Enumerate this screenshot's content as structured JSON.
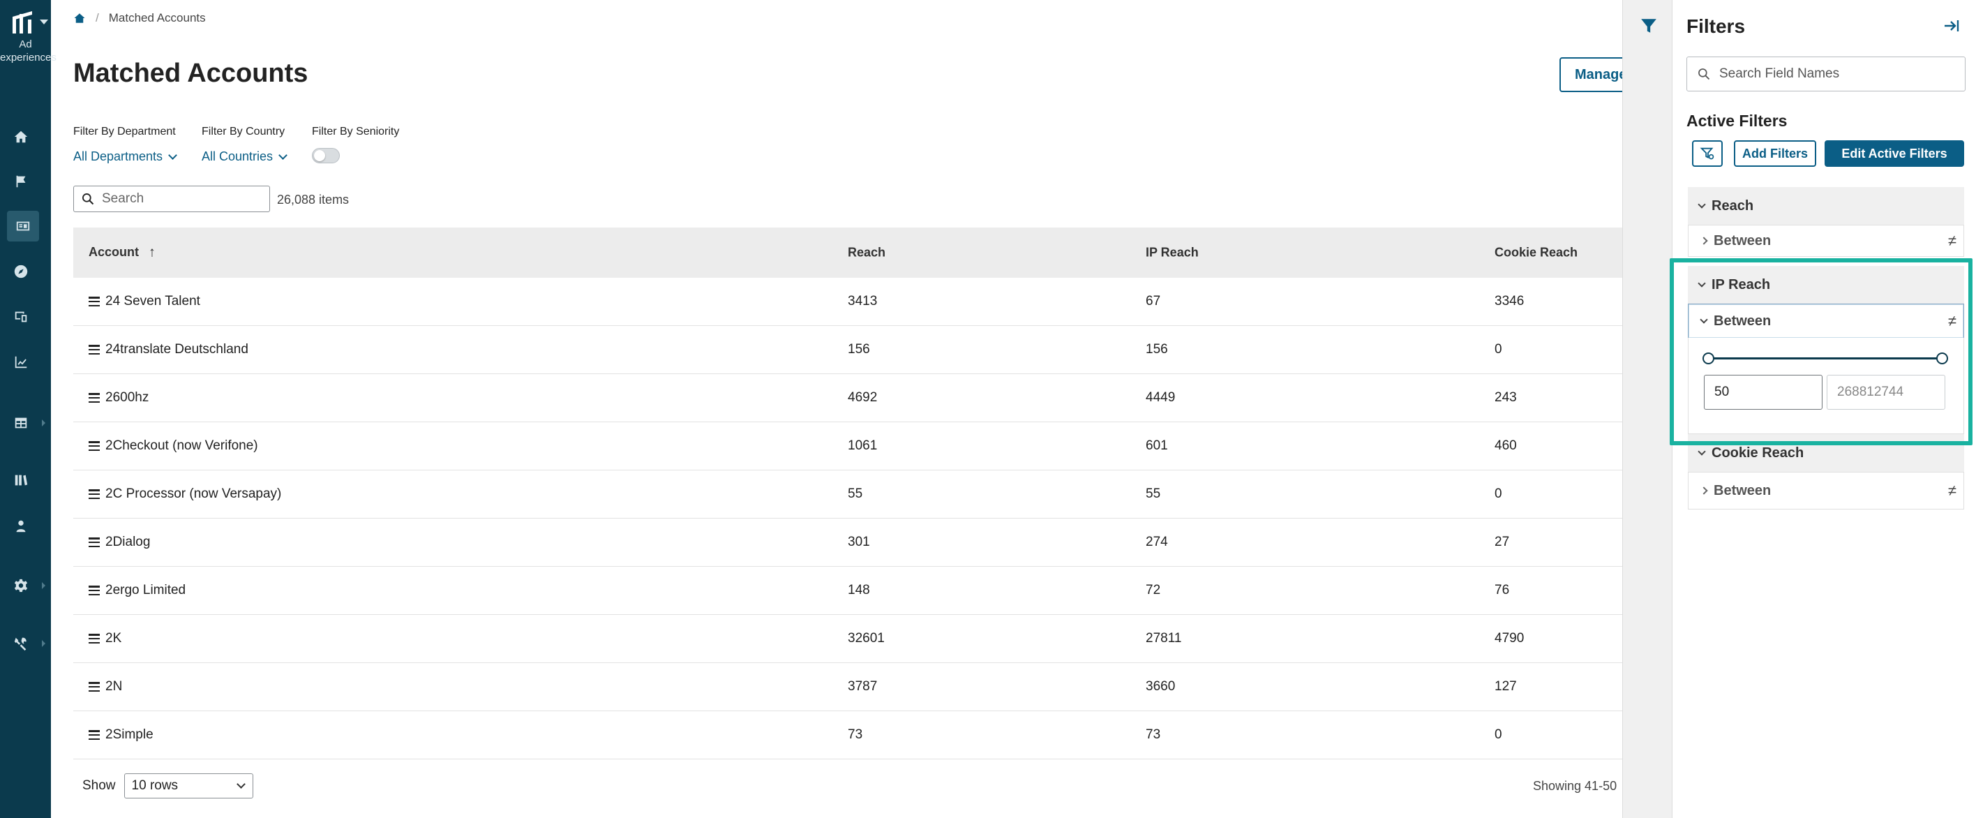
{
  "app": {
    "logo_text": "Ad experiences"
  },
  "breadcrumb": {
    "current": "Matched Accounts"
  },
  "page": {
    "title": "Matched Accounts",
    "manage_label": "Manage"
  },
  "filters_bar": {
    "department": {
      "label": "Filter By Department",
      "value": "All Departments"
    },
    "country": {
      "label": "Filter By Country",
      "value": "All Countries"
    },
    "seniority": {
      "label": "Filter By Seniority",
      "enabled": false
    }
  },
  "search": {
    "placeholder": "Search",
    "item_count": "26,088 items"
  },
  "table": {
    "columns": [
      "Account",
      "Reach",
      "IP Reach",
      "Cookie Reach"
    ],
    "sort_column": "Account",
    "sort_direction": "ascending",
    "rows": [
      {
        "account": "24 Seven Talent",
        "reach": "3413",
        "ip_reach": "67",
        "cookie_reach": "3346"
      },
      {
        "account": "24translate Deutschland",
        "reach": "156",
        "ip_reach": "156",
        "cookie_reach": "0"
      },
      {
        "account": "2600hz",
        "reach": "4692",
        "ip_reach": "4449",
        "cookie_reach": "243"
      },
      {
        "account": "2Checkout (now Verifone)",
        "reach": "1061",
        "ip_reach": "601",
        "cookie_reach": "460"
      },
      {
        "account": "2C Processor (now Versapay)",
        "reach": "55",
        "ip_reach": "55",
        "cookie_reach": "0"
      },
      {
        "account": "2Dialog",
        "reach": "301",
        "ip_reach": "274",
        "cookie_reach": "27"
      },
      {
        "account": "2ergo Limited",
        "reach": "148",
        "ip_reach": "72",
        "cookie_reach": "76"
      },
      {
        "account": "2K",
        "reach": "32601",
        "ip_reach": "27811",
        "cookie_reach": "4790"
      },
      {
        "account": "2N",
        "reach": "3787",
        "ip_reach": "3660",
        "cookie_reach": "127"
      },
      {
        "account": "2Simple",
        "reach": "73",
        "ip_reach": "73",
        "cookie_reach": "0"
      }
    ]
  },
  "pager": {
    "show_label": "Show",
    "rows_value": "10 rows",
    "showing": "Showing 41-50"
  },
  "filters_panel": {
    "title": "Filters",
    "search_placeholder": "Search Field Names",
    "active_title": "Active Filters",
    "add_label": "Add Filters",
    "edit_label": "Edit Active Filters",
    "sections": [
      {
        "name": "Reach",
        "condition": "Between",
        "expanded": false
      },
      {
        "name": "IP Reach",
        "condition": "Between",
        "expanded": true,
        "min_value": "50",
        "max_placeholder": "268812744"
      },
      {
        "name": "Cookie Reach",
        "condition": "Between",
        "expanded": false
      }
    ],
    "not_equal_symbol": "≠"
  },
  "colors": {
    "rail": "#0b3a4d",
    "accent": "#0b5e86",
    "highlight": "#19b2a0"
  },
  "icons": [
    "home-icon",
    "flag-icon",
    "id-card-icon",
    "compass-icon",
    "devices-icon",
    "chart-line-icon",
    "table-icon",
    "library-icon",
    "user-badge-icon",
    "gear-icon",
    "tools-icon",
    "filter-icon",
    "collapse-panel-icon",
    "search-icon",
    "filter-settings-icon"
  ]
}
